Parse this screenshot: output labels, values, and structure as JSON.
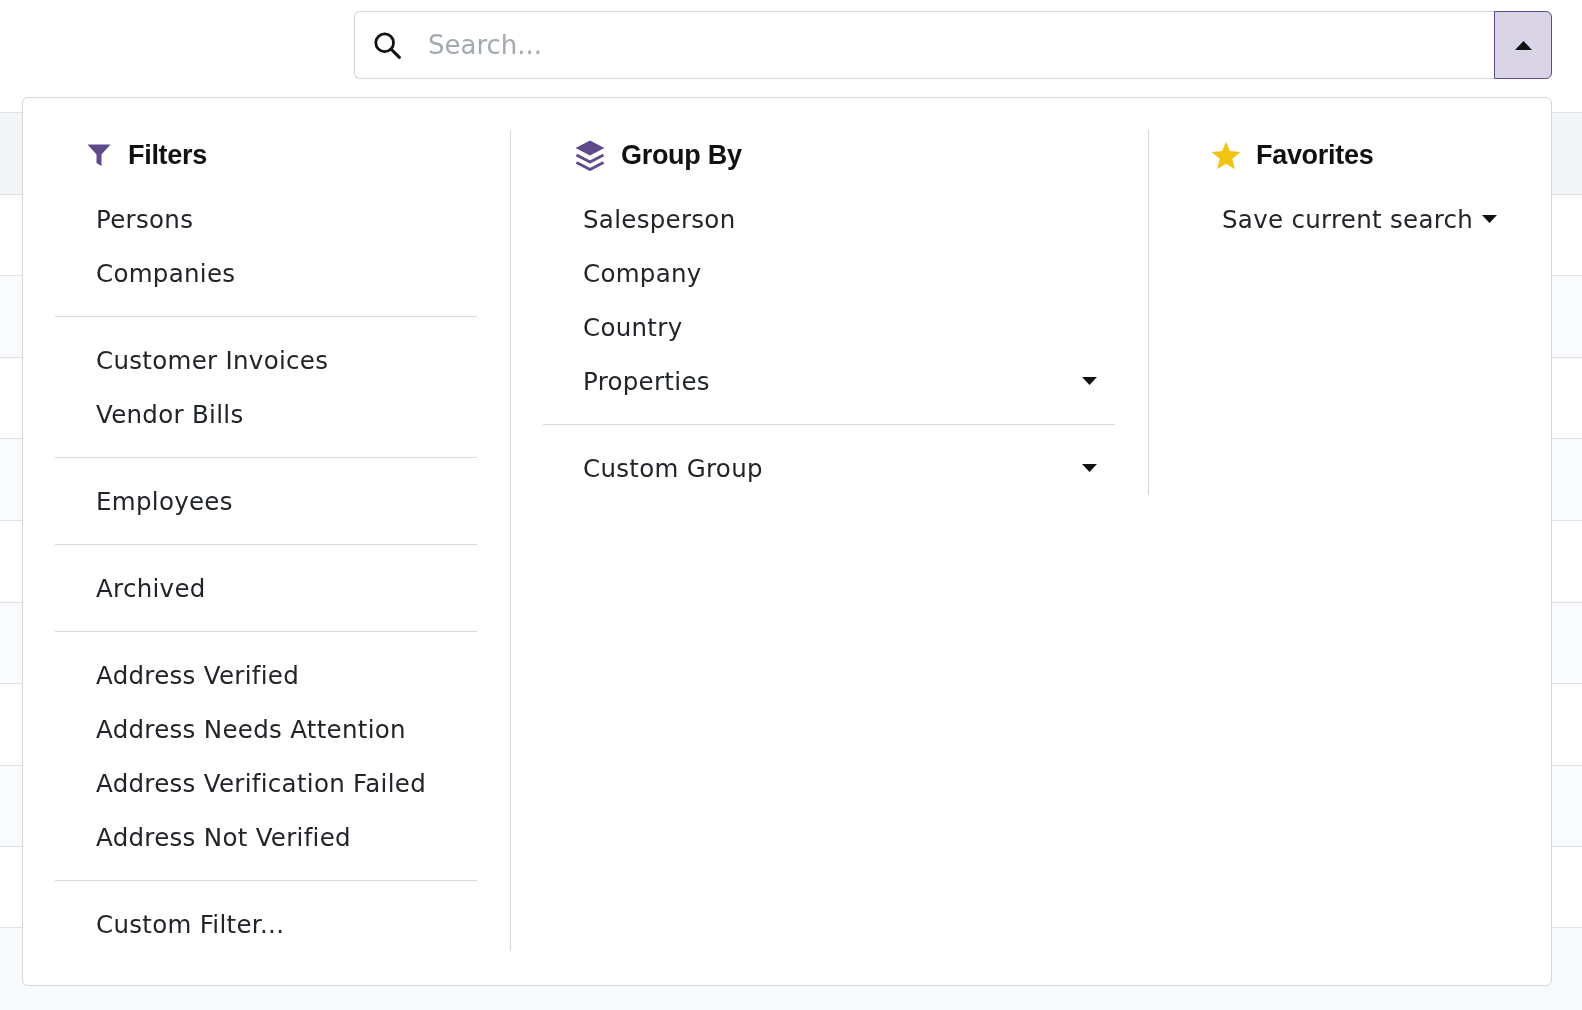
{
  "search": {
    "placeholder": "Search...",
    "expanded": true
  },
  "filters": {
    "title": "Filters",
    "groups": [
      {
        "items": [
          {
            "label": "Persons",
            "kind": "option"
          },
          {
            "label": "Companies",
            "kind": "option"
          }
        ]
      },
      {
        "items": [
          {
            "label": "Customer Invoices",
            "kind": "option"
          },
          {
            "label": "Vendor Bills",
            "kind": "option"
          }
        ]
      },
      {
        "items": [
          {
            "label": "Employees",
            "kind": "option"
          }
        ]
      },
      {
        "items": [
          {
            "label": "Archived",
            "kind": "option"
          }
        ]
      },
      {
        "items": [
          {
            "label": "Address Verified",
            "kind": "option"
          },
          {
            "label": "Address Needs Attention",
            "kind": "option"
          },
          {
            "label": "Address Verification Failed",
            "kind": "option"
          },
          {
            "label": "Address Not Verified",
            "kind": "option"
          }
        ]
      },
      {
        "items": [
          {
            "label": "Custom Filter...",
            "kind": "option"
          }
        ]
      }
    ]
  },
  "group_by": {
    "title": "Group By",
    "groups": [
      {
        "items": [
          {
            "label": "Salesperson",
            "kind": "option"
          },
          {
            "label": "Company",
            "kind": "option"
          },
          {
            "label": "Country",
            "kind": "option"
          },
          {
            "label": "Properties",
            "kind": "dropdown"
          }
        ]
      },
      {
        "items": [
          {
            "label": "Custom Group",
            "kind": "dropdown"
          }
        ]
      }
    ]
  },
  "favorites": {
    "title": "Favorites",
    "items": [
      {
        "label": "Save current search",
        "kind": "dropdown"
      }
    ]
  }
}
